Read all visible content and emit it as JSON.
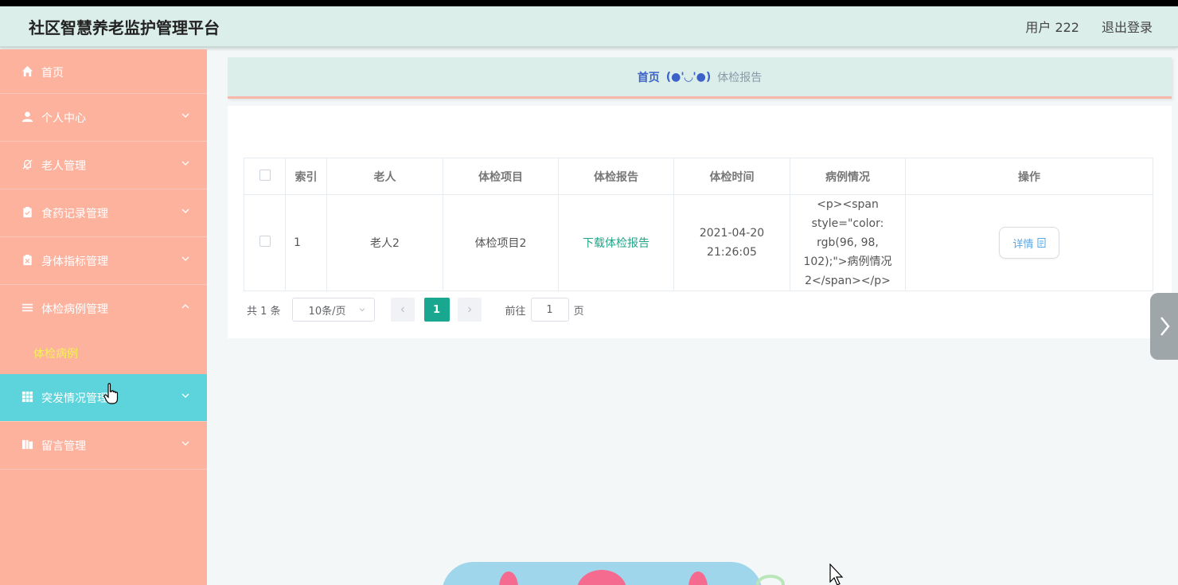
{
  "header": {
    "title": "社区智慧养老监护管理平台",
    "user": "用户 222",
    "logout": "退出登录"
  },
  "sidebar": {
    "items": [
      {
        "label": "首页",
        "icon": "home-icon"
      },
      {
        "label": "个人中心",
        "icon": "user-icon"
      },
      {
        "label": "老人管理",
        "icon": "bell-off-icon"
      },
      {
        "label": "食药记录管理",
        "icon": "clipboard-check-icon"
      },
      {
        "label": "身体指标管理",
        "icon": "clipboard-x-icon"
      },
      {
        "label": "体检病例管理",
        "icon": "list-icon"
      },
      {
        "label": "突发情况管理",
        "icon": "grid-icon"
      },
      {
        "label": "留言管理",
        "icon": "book-icon"
      }
    ],
    "submenu": {
      "label": "体检病例"
    }
  },
  "breadcrumb": {
    "home": "首页",
    "separator": "(●'◡'●)",
    "current": "体检报告"
  },
  "table": {
    "headers": [
      "索引",
      "老人",
      "体检项目",
      "体检报告",
      "体检时间",
      "病例情况",
      "操作"
    ],
    "rows": [
      {
        "index": "1",
        "elder": "老人2",
        "item": "体检项目2",
        "report": "下载体检报告",
        "time": "2021-04-20 21:26:05",
        "case": "<p><span style=\"color: rgb(96, 98, 102);\">病例情况2</span></p>",
        "action": "详情"
      }
    ]
  },
  "pagination": {
    "total": "共 1 条",
    "page_size": "10条/页",
    "current_page": "1",
    "goto_label": "前往",
    "goto_value": "1",
    "page_suffix": "页"
  },
  "colors": {
    "sidebar_bg": "#fdb29e",
    "sidebar_active": "#5dd4db",
    "header_bg": "#dbeee9",
    "accent": "#1aa78f",
    "submenu_text": "#f6ef5a"
  }
}
